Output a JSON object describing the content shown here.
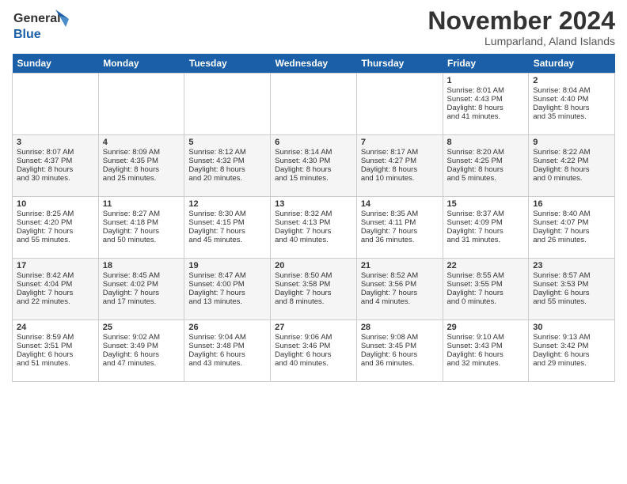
{
  "header": {
    "logo_line1": "General",
    "logo_line2": "Blue",
    "month_title": "November 2024",
    "location": "Lumparland, Aland Islands"
  },
  "days_of_week": [
    "Sunday",
    "Monday",
    "Tuesday",
    "Wednesday",
    "Thursday",
    "Friday",
    "Saturday"
  ],
  "weeks": [
    [
      {
        "day": "",
        "info": ""
      },
      {
        "day": "",
        "info": ""
      },
      {
        "day": "",
        "info": ""
      },
      {
        "day": "",
        "info": ""
      },
      {
        "day": "",
        "info": ""
      },
      {
        "day": "1",
        "info": "Sunrise: 8:01 AM\nSunset: 4:43 PM\nDaylight: 8 hours\nand 41 minutes."
      },
      {
        "day": "2",
        "info": "Sunrise: 8:04 AM\nSunset: 4:40 PM\nDaylight: 8 hours\nand 35 minutes."
      }
    ],
    [
      {
        "day": "3",
        "info": "Sunrise: 8:07 AM\nSunset: 4:37 PM\nDaylight: 8 hours\nand 30 minutes."
      },
      {
        "day": "4",
        "info": "Sunrise: 8:09 AM\nSunset: 4:35 PM\nDaylight: 8 hours\nand 25 minutes."
      },
      {
        "day": "5",
        "info": "Sunrise: 8:12 AM\nSunset: 4:32 PM\nDaylight: 8 hours\nand 20 minutes."
      },
      {
        "day": "6",
        "info": "Sunrise: 8:14 AM\nSunset: 4:30 PM\nDaylight: 8 hours\nand 15 minutes."
      },
      {
        "day": "7",
        "info": "Sunrise: 8:17 AM\nSunset: 4:27 PM\nDaylight: 8 hours\nand 10 minutes."
      },
      {
        "day": "8",
        "info": "Sunrise: 8:20 AM\nSunset: 4:25 PM\nDaylight: 8 hours\nand 5 minutes."
      },
      {
        "day": "9",
        "info": "Sunrise: 8:22 AM\nSunset: 4:22 PM\nDaylight: 8 hours\nand 0 minutes."
      }
    ],
    [
      {
        "day": "10",
        "info": "Sunrise: 8:25 AM\nSunset: 4:20 PM\nDaylight: 7 hours\nand 55 minutes."
      },
      {
        "day": "11",
        "info": "Sunrise: 8:27 AM\nSunset: 4:18 PM\nDaylight: 7 hours\nand 50 minutes."
      },
      {
        "day": "12",
        "info": "Sunrise: 8:30 AM\nSunset: 4:15 PM\nDaylight: 7 hours\nand 45 minutes."
      },
      {
        "day": "13",
        "info": "Sunrise: 8:32 AM\nSunset: 4:13 PM\nDaylight: 7 hours\nand 40 minutes."
      },
      {
        "day": "14",
        "info": "Sunrise: 8:35 AM\nSunset: 4:11 PM\nDaylight: 7 hours\nand 36 minutes."
      },
      {
        "day": "15",
        "info": "Sunrise: 8:37 AM\nSunset: 4:09 PM\nDaylight: 7 hours\nand 31 minutes."
      },
      {
        "day": "16",
        "info": "Sunrise: 8:40 AM\nSunset: 4:07 PM\nDaylight: 7 hours\nand 26 minutes."
      }
    ],
    [
      {
        "day": "17",
        "info": "Sunrise: 8:42 AM\nSunset: 4:04 PM\nDaylight: 7 hours\nand 22 minutes."
      },
      {
        "day": "18",
        "info": "Sunrise: 8:45 AM\nSunset: 4:02 PM\nDaylight: 7 hours\nand 17 minutes."
      },
      {
        "day": "19",
        "info": "Sunrise: 8:47 AM\nSunset: 4:00 PM\nDaylight: 7 hours\nand 13 minutes."
      },
      {
        "day": "20",
        "info": "Sunrise: 8:50 AM\nSunset: 3:58 PM\nDaylight: 7 hours\nand 8 minutes."
      },
      {
        "day": "21",
        "info": "Sunrise: 8:52 AM\nSunset: 3:56 PM\nDaylight: 7 hours\nand 4 minutes."
      },
      {
        "day": "22",
        "info": "Sunrise: 8:55 AM\nSunset: 3:55 PM\nDaylight: 7 hours\nand 0 minutes."
      },
      {
        "day": "23",
        "info": "Sunrise: 8:57 AM\nSunset: 3:53 PM\nDaylight: 6 hours\nand 55 minutes."
      }
    ],
    [
      {
        "day": "24",
        "info": "Sunrise: 8:59 AM\nSunset: 3:51 PM\nDaylight: 6 hours\nand 51 minutes."
      },
      {
        "day": "25",
        "info": "Sunrise: 9:02 AM\nSunset: 3:49 PM\nDaylight: 6 hours\nand 47 minutes."
      },
      {
        "day": "26",
        "info": "Sunrise: 9:04 AM\nSunset: 3:48 PM\nDaylight: 6 hours\nand 43 minutes."
      },
      {
        "day": "27",
        "info": "Sunrise: 9:06 AM\nSunset: 3:46 PM\nDaylight: 6 hours\nand 40 minutes."
      },
      {
        "day": "28",
        "info": "Sunrise: 9:08 AM\nSunset: 3:45 PM\nDaylight: 6 hours\nand 36 minutes."
      },
      {
        "day": "29",
        "info": "Sunrise: 9:10 AM\nSunset: 3:43 PM\nDaylight: 6 hours\nand 32 minutes."
      },
      {
        "day": "30",
        "info": "Sunrise: 9:13 AM\nSunset: 3:42 PM\nDaylight: 6 hours\nand 29 minutes."
      }
    ]
  ]
}
